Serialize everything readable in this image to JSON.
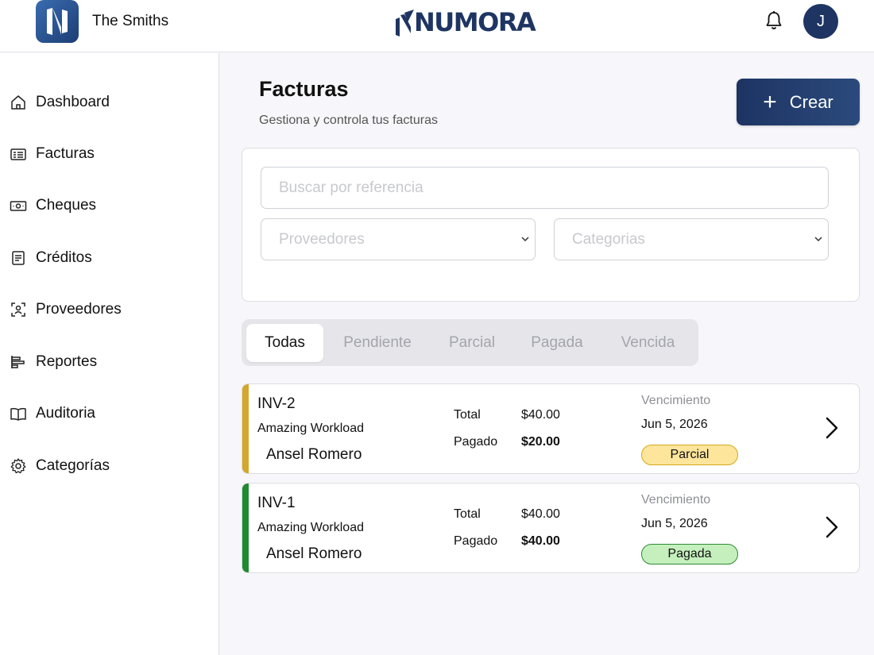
{
  "header": {
    "org_name": "The Smiths",
    "brand": "NUMORA",
    "avatar_initial": "J"
  },
  "sidebar": {
    "items": [
      {
        "label": "Dashboard",
        "icon": "home-icon"
      },
      {
        "label": "Facturas",
        "icon": "invoice-icon"
      },
      {
        "label": "Cheques",
        "icon": "banknote-icon"
      },
      {
        "label": "Créditos",
        "icon": "document-icon"
      },
      {
        "label": "Proveedores",
        "icon": "user-scan-icon"
      },
      {
        "label": "Reportes",
        "icon": "report-icon"
      },
      {
        "label": "Auditoria",
        "icon": "book-icon"
      },
      {
        "label": "Categorías",
        "icon": "gear-icon"
      }
    ]
  },
  "page": {
    "title": "Facturas",
    "subtitle": "Gestiona y controla tus facturas",
    "create_label": "Crear"
  },
  "filters": {
    "search_placeholder": "Buscar por referencia",
    "providers_placeholder": "Proveedores",
    "categories_placeholder": "Categorias"
  },
  "tabs": [
    {
      "label": "Todas",
      "active": true
    },
    {
      "label": "Pendiente",
      "active": false
    },
    {
      "label": "Parcial",
      "active": false
    },
    {
      "label": "Pagada",
      "active": false
    },
    {
      "label": "Vencida",
      "active": false
    }
  ],
  "invoice_labels": {
    "total": "Total",
    "paid": "Pagado",
    "due": "Vencimiento"
  },
  "invoices": [
    {
      "ref": "INV-2",
      "workload": "Amazing Workload",
      "provider": "Ansel Romero",
      "total": "$40.00",
      "paid": "$20.00",
      "due_date": "Jun 5, 2026",
      "status": "Parcial",
      "accent_color": "#d4a62a"
    },
    {
      "ref": "INV-1",
      "workload": "Amazing Workload",
      "provider": "Ansel Romero",
      "total": "$40.00",
      "paid": "$40.00",
      "due_date": "Jun 5, 2026",
      "status": "Pagada",
      "accent_color": "#1f8a2f"
    }
  ],
  "colors": {
    "brand_navy": "#1e3563",
    "parcial_badge": "#fde59b",
    "pagada_badge": "#c5f0bd"
  }
}
